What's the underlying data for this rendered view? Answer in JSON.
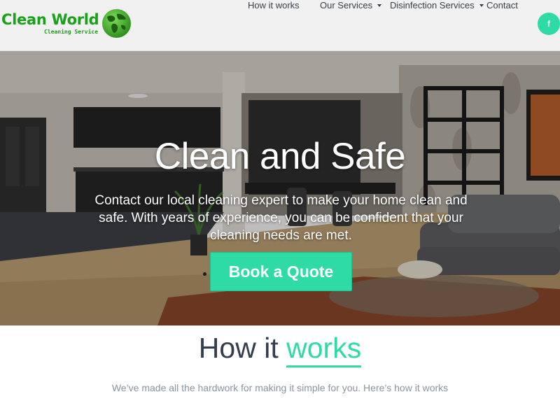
{
  "brand": {
    "name": "Clean World",
    "tagline": "Cleaning Service",
    "icon": "globe-icon"
  },
  "nav": {
    "items": [
      {
        "label": "How it works",
        "dropdown": false
      },
      {
        "label": "Our Services",
        "dropdown": true
      },
      {
        "label": "Disinfection Services",
        "dropdown": true
      },
      {
        "label": "Contact",
        "dropdown": false
      }
    ],
    "social": {
      "label": "f",
      "icon": "facebook-icon"
    }
  },
  "hero": {
    "title": "Clean and Safe",
    "text": "Contact our local cleaning expert to make your home clean and safe. With years of experience, you can be confident that your cleaning needs are met.",
    "button": "Book a Quote"
  },
  "how": {
    "title_prefix": "How it",
    "title_accent": "works",
    "subtitle": "We’ve made all the hardwork for making it simple for you. Here’s how it works"
  },
  "colors": {
    "accent": "#2fdba5",
    "brand_green": "#1aa11a",
    "heading": "#333d4d",
    "muted": "#8a94a3",
    "header_bg": "#f1f1f1"
  }
}
